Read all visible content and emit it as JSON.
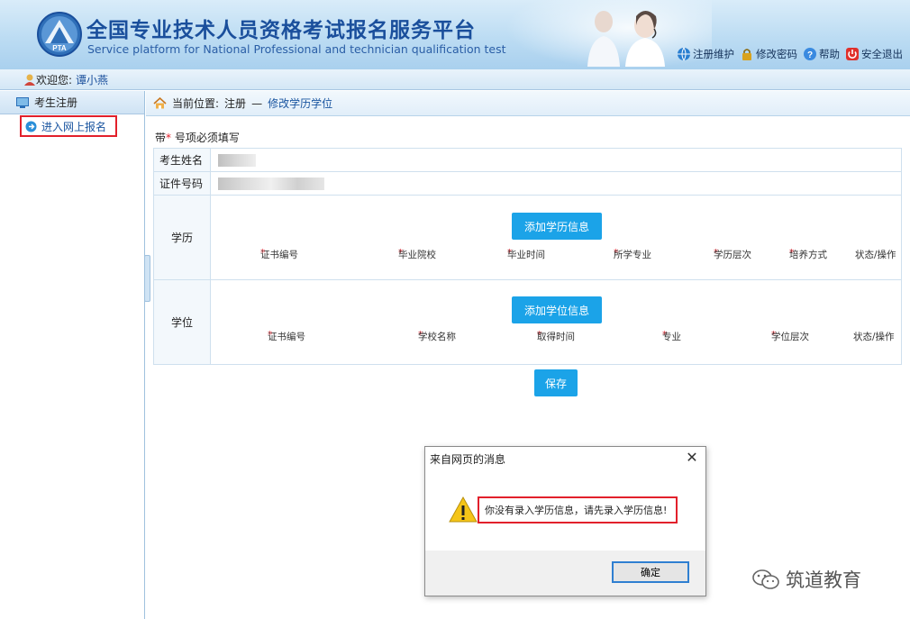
{
  "header": {
    "title_cn": "全国专业技术人员资格考试报名服务平台",
    "title_en": "Service platform for National Professional and technician qualification test",
    "links": [
      {
        "label": "注册维护",
        "icon": "globe-icon"
      },
      {
        "label": "修改密码",
        "icon": "lock-icon"
      },
      {
        "label": "帮助",
        "icon": "help-icon"
      },
      {
        "label": "安全退出",
        "icon": "power-icon"
      }
    ]
  },
  "welcome": {
    "prefix": "欢迎您:",
    "user": "谭小燕"
  },
  "sidebar": {
    "heading": "考生注册",
    "items": [
      {
        "label": "进入网上报名"
      }
    ]
  },
  "breadcrumb": {
    "prefix": "当前位置:",
    "path": "注册",
    "sep": "—",
    "current": "修改学历学位"
  },
  "form": {
    "required_note_pre": "带",
    "required_note_post": "号项必须填写",
    "name_label": "考生姓名",
    "id_label": "证件号码",
    "education": {
      "label": "学历",
      "add_button": "添加学历信息",
      "columns": [
        "证书编号",
        "毕业院校",
        "毕业时间",
        "所学专业",
        "学历层次",
        "培养方式",
        "状态/操作"
      ],
      "required": [
        true,
        true,
        true,
        true,
        true,
        true,
        false
      ]
    },
    "degree": {
      "label": "学位",
      "add_button": "添加学位信息",
      "columns": [
        "证书编号",
        "学校名称",
        "取得时间",
        "专业",
        "学位层次",
        "状态/操作"
      ],
      "required": [
        true,
        true,
        true,
        true,
        true,
        false
      ]
    },
    "save_button": "保存"
  },
  "dialog": {
    "title": "来自网页的消息",
    "message": "你没有录入学历信息，请先录入学历信息!",
    "ok_button": "确定",
    "close": "✕"
  },
  "watermark": "筑道教育",
  "colors": {
    "accent": "#1ba3e8",
    "highlight": "#e2202b",
    "title": "#1a4f9c"
  }
}
